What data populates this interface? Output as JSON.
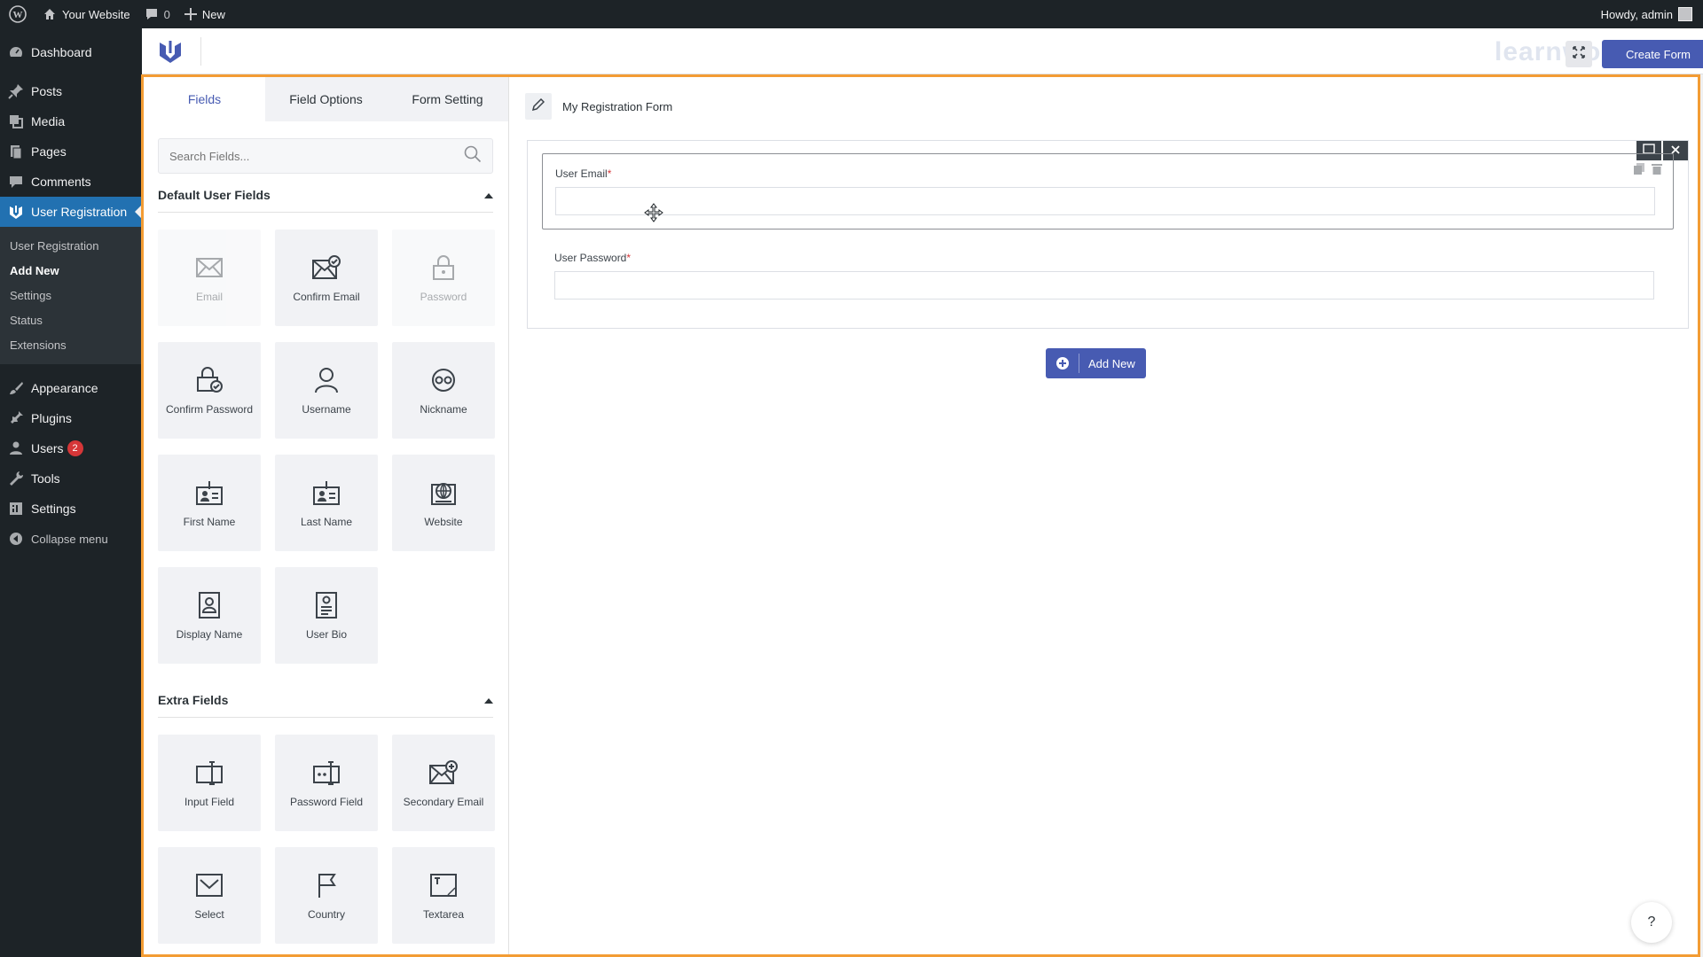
{
  "adminbar": {
    "site_name": "Your Website",
    "comments_count": "0",
    "new_label": "New",
    "howdy": "Howdy, admin"
  },
  "sidebar": {
    "dashboard": "Dashboard",
    "posts": "Posts",
    "media": "Media",
    "pages": "Pages",
    "comments": "Comments",
    "user_registration": "User Registration",
    "submenu": [
      "User Registration",
      "Add New",
      "Settings",
      "Status",
      "Extensions"
    ],
    "appearance": "Appearance",
    "plugins": "Plugins",
    "users": "Users",
    "users_badge": "2",
    "tools": "Tools",
    "settings": "Settings",
    "collapse": "Collapse menu"
  },
  "topbar": {
    "create_form": "Create Form",
    "watermark": "learnwoo"
  },
  "left_panel": {
    "tabs": [
      "Fields",
      "Field Options",
      "Form Setting"
    ],
    "search_placeholder": "Search Fields...",
    "default_section": "Default User Fields",
    "default_fields": [
      "Email",
      "Confirm Email",
      "Password",
      "Confirm Password",
      "Username",
      "Nickname",
      "First Name",
      "Last Name",
      "Website",
      "Display Name",
      "User Bio"
    ],
    "extra_section": "Extra Fields",
    "extra_fields": [
      "Input Field",
      "Password Field",
      "Secondary Email",
      "Select",
      "Country",
      "Textarea"
    ]
  },
  "form": {
    "title": "My Registration Form",
    "fields": [
      {
        "label": "User Email",
        "required_mark": "*"
      },
      {
        "label": "User Password",
        "required_mark": "*"
      }
    ],
    "add_new": "Add New",
    "help": "?"
  },
  "colors": {
    "accent": "#475bb2",
    "frame": "#f39c34",
    "wp_blue": "#2271b1",
    "admin_dark": "#1d2327"
  }
}
